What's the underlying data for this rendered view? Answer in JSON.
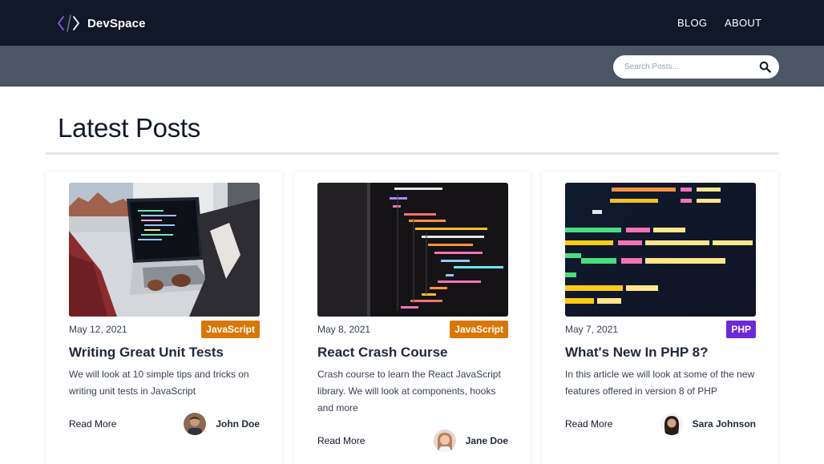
{
  "header": {
    "brand": "DevSpace",
    "nav": [
      {
        "label": "BLOG"
      },
      {
        "label": "ABOUT"
      }
    ]
  },
  "search": {
    "placeholder": "Search Posts...",
    "button_icon": "search-icon"
  },
  "main": {
    "title": "Latest Posts"
  },
  "posts": [
    {
      "date": "May 12, 2021",
      "category": "JavaScript",
      "category_color": "#d97706",
      "title": "Writing Great Unit Tests",
      "excerpt": "We will look at 10 simple tips and tricks on writing unit tests in JavaScript",
      "read_more": "Read More",
      "author": "John Doe"
    },
    {
      "date": "May 8, 2021",
      "category": "JavaScript",
      "category_color": "#d97706",
      "title": "React Crash Course",
      "excerpt": "Crash course to learn the React JavaScript library. We will look at components, hooks and more",
      "read_more": "Read More",
      "author": "Jane Doe"
    },
    {
      "date": "May 7, 2021",
      "category": "PHP",
      "category_color": "#6d28d9",
      "title": "What's New In PHP 8?",
      "excerpt": "In this article we will look at some of the new features offered in version 8 of PHP",
      "read_more": "Read More",
      "author": "Sara Johnson"
    }
  ],
  "colors": {
    "navbar": "#111827",
    "search_bar": "#4b5563",
    "javascript_tag": "#d97706",
    "php_tag": "#6d28d9"
  }
}
